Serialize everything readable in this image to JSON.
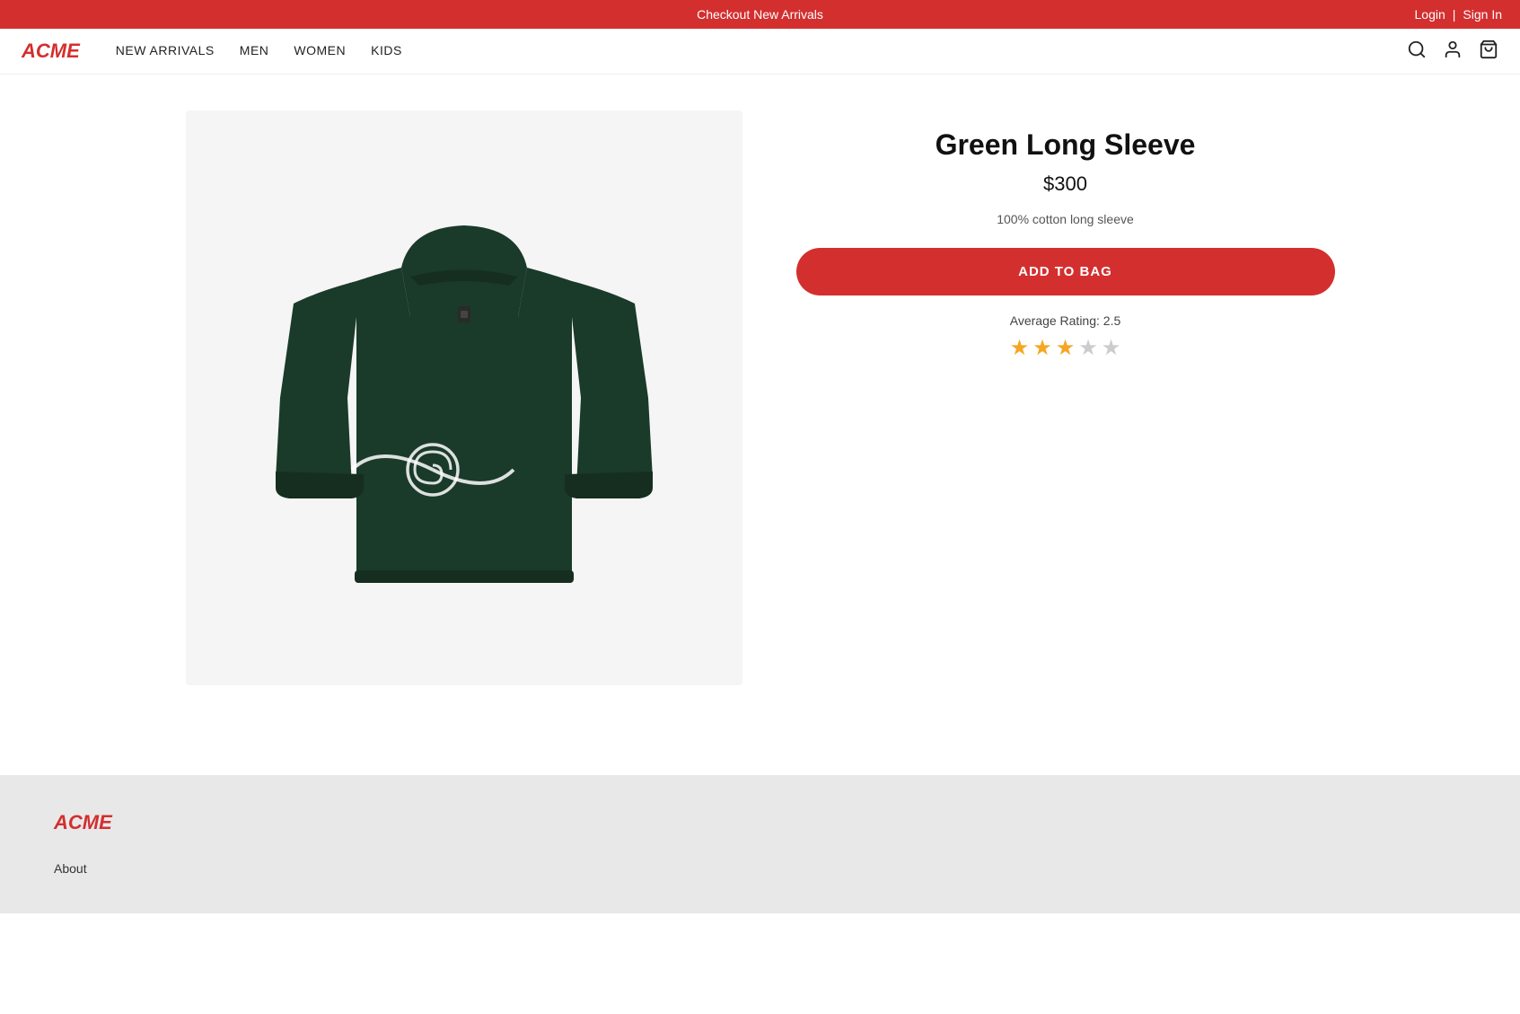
{
  "banner": {
    "text": "Checkout New Arrivals",
    "login_label": "Login",
    "separator": "|",
    "signin_label": "Sign In"
  },
  "navbar": {
    "logo": "ACME",
    "links": [
      {
        "label": "NEW ARRIVALS",
        "id": "new-arrivals"
      },
      {
        "label": "MEN",
        "id": "men"
      },
      {
        "label": "WOMEN",
        "id": "women"
      },
      {
        "label": "KIDS",
        "id": "kids"
      }
    ]
  },
  "product": {
    "title": "Green Long Sleeve",
    "price": "$300",
    "description": "100% cotton long sleeve",
    "add_to_bag_label": "ADD TO BAG",
    "rating_label": "Average Rating: 2.5",
    "rating_value": 2.5,
    "stars": [
      {
        "type": "filled"
      },
      {
        "type": "filled"
      },
      {
        "type": "half"
      },
      {
        "type": "empty"
      },
      {
        "type": "empty"
      }
    ]
  },
  "footer": {
    "logo": "ACME",
    "links": [
      {
        "label": "About"
      }
    ]
  }
}
